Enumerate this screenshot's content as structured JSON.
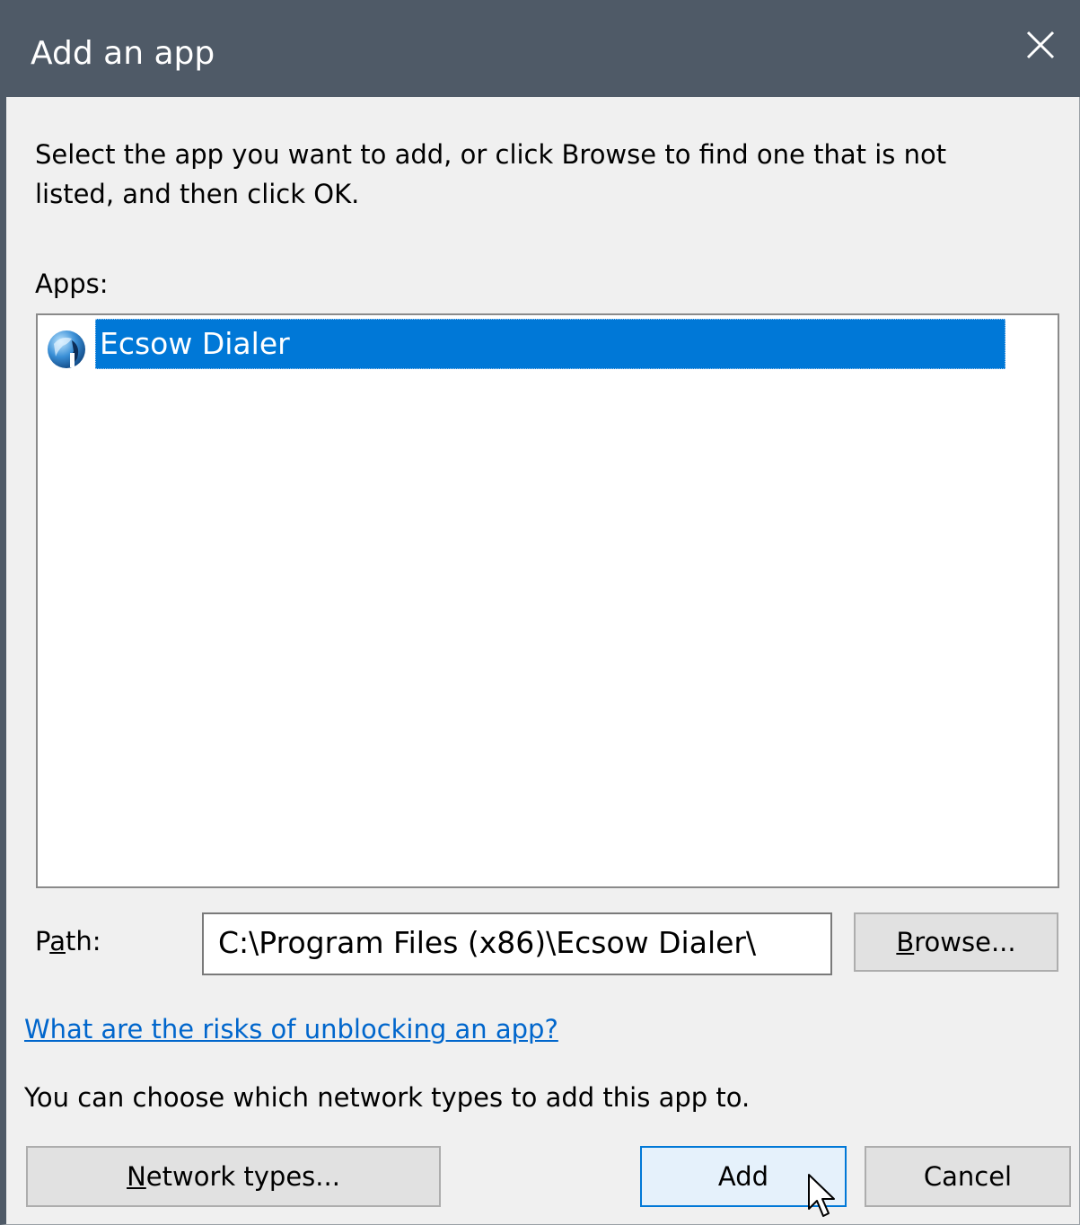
{
  "window": {
    "title": "Add an app",
    "close_icon": "close-icon"
  },
  "instructions": "Select the app you want to add, or click Browse to find one that is not listed, and then click OK.",
  "apps": {
    "label": "Apps:",
    "items": [
      {
        "label": "Ecsow Dialer",
        "icon": "app-globe-icon",
        "selected": true
      }
    ]
  },
  "path": {
    "label_pre": "P",
    "label_mnemonic": "a",
    "label_post": "th:",
    "value": "C:\\Program Files (x86)\\Ecsow Dialer\\"
  },
  "buttons": {
    "browse_mnemonic": "B",
    "browse_rest": "rowse...",
    "network_mnemonic": "N",
    "network_rest": "etwork types...",
    "add": "Add",
    "cancel": "Cancel"
  },
  "risks_link": "What are the risks of unblocking an app?",
  "network_note": "You can choose which network types to add this app to.",
  "colors": {
    "titlebar": "#4f5a67",
    "selection": "#0078d7",
    "link": "#0066cc",
    "dialog_bg": "#f0f0f0"
  }
}
